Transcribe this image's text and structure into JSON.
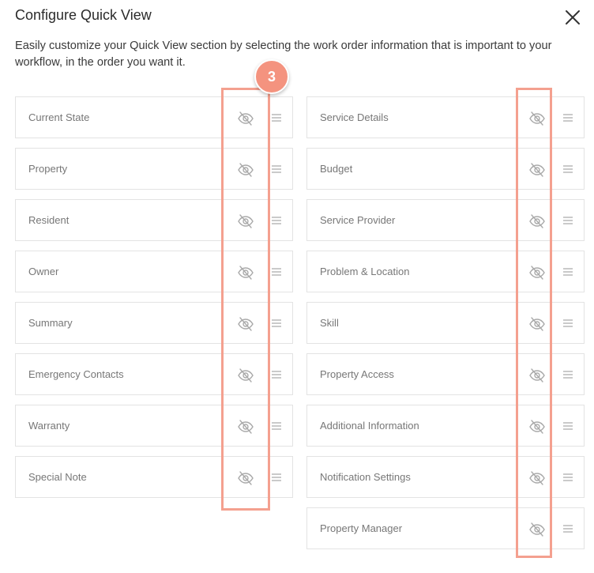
{
  "dialog": {
    "title": "Configure Quick View",
    "description": "Easily customize your Quick View section by selecting the work order information that is important to your workflow, in the order you want it."
  },
  "annotation": {
    "badge": "3",
    "color": "#f4a08f"
  },
  "left_items": [
    {
      "label": "Current State",
      "icon": "eye-slash-icon"
    },
    {
      "label": "Property",
      "icon": "eye-slash-icon"
    },
    {
      "label": "Resident",
      "icon": "eye-slash-icon"
    },
    {
      "label": "Owner",
      "icon": "eye-slash-icon"
    },
    {
      "label": "Summary",
      "icon": "eye-slash-icon"
    },
    {
      "label": "Emergency Contacts",
      "icon": "eye-slash-icon"
    },
    {
      "label": "Warranty",
      "icon": "eye-slash-icon"
    },
    {
      "label": "Special Note",
      "icon": "eye-slash-icon"
    }
  ],
  "right_items": [
    {
      "label": "Service Details",
      "icon": "eye-slash-icon"
    },
    {
      "label": "Budget",
      "icon": "eye-slash-icon"
    },
    {
      "label": "Service Provider",
      "icon": "eye-slash-icon"
    },
    {
      "label": "Problem & Location",
      "icon": "eye-slash-icon"
    },
    {
      "label": "Skill",
      "icon": "eye-slash-icon"
    },
    {
      "label": "Property Access",
      "icon": "eye-slash-icon"
    },
    {
      "label": "Additional Information",
      "icon": "eye-slash-icon"
    },
    {
      "label": "Notification Settings",
      "icon": "eye-slash-icon"
    },
    {
      "label": "Property Manager",
      "icon": "eye-slash-icon"
    }
  ]
}
